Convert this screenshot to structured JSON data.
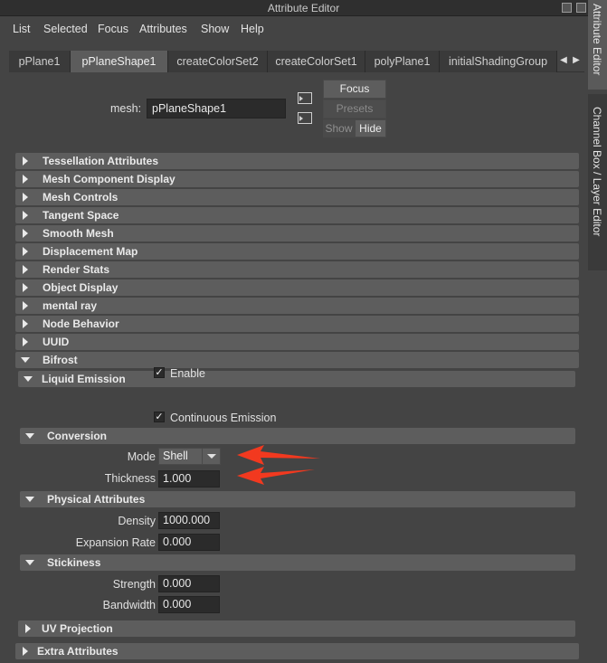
{
  "window": {
    "title": "Attribute Editor"
  },
  "menu": [
    "List",
    "Selected",
    "Focus",
    "Attributes",
    "Show",
    "Help"
  ],
  "tabs": [
    {
      "label": "pPlane1",
      "active": false
    },
    {
      "label": "pPlaneShape1",
      "active": true
    },
    {
      "label": "createColorSet2",
      "active": false
    },
    {
      "label": "createColorSet1",
      "active": false
    },
    {
      "label": "polyPlane1",
      "active": false
    },
    {
      "label": "initialShadingGroup",
      "active": false
    }
  ],
  "node": {
    "type_label": "mesh:",
    "name": "pPlaneShape1"
  },
  "buttons": {
    "focus": "Focus",
    "presets": "Presets",
    "show": "Show",
    "hide": "Hide"
  },
  "sections": [
    {
      "label": "Tessellation Attributes",
      "expanded": false
    },
    {
      "label": "Mesh Component Display",
      "expanded": false
    },
    {
      "label": "Mesh Controls",
      "expanded": false
    },
    {
      "label": "Tangent Space",
      "expanded": false
    },
    {
      "label": "Smooth Mesh",
      "expanded": false
    },
    {
      "label": "Displacement Map",
      "expanded": false
    },
    {
      "label": "Render Stats",
      "expanded": false
    },
    {
      "label": "Object Display",
      "expanded": false
    },
    {
      "label": "mental ray",
      "expanded": false
    },
    {
      "label": "Node Behavior",
      "expanded": false
    },
    {
      "label": "UUID",
      "expanded": false
    },
    {
      "label": "Bifrost",
      "expanded": true
    }
  ],
  "bifrost": {
    "liquid_emission": {
      "label": "Liquid Emission",
      "enable": {
        "label": "Enable",
        "checked": true
      },
      "continuous": {
        "label": "Continuous Emission",
        "checked": true
      }
    },
    "conversion": {
      "label": "Conversion",
      "mode_label": "Mode",
      "mode_value": "Shell",
      "thickness_label": "Thickness",
      "thickness_value": "1.000"
    },
    "physical": {
      "label": "Physical Attributes",
      "density_label": "Density",
      "density_value": "1000.000",
      "expansion_label": "Expansion Rate",
      "expansion_value": "0.000"
    },
    "stickiness": {
      "label": "Stickiness",
      "strength_label": "Strength",
      "strength_value": "0.000",
      "bandwidth_label": "Bandwidth",
      "bandwidth_value": "0.000"
    },
    "uv_projection": {
      "label": "UV Projection"
    }
  },
  "extra": {
    "label": "Extra Attributes"
  },
  "side_tabs": {
    "attribute_editor": "Attribute Editor",
    "channel_box": "Channel Box / Layer Editor"
  },
  "colors": {
    "annotation_arrow": "#f2391f",
    "panel_bg": "#444444",
    "frame_bg": "#5d5d5d"
  }
}
